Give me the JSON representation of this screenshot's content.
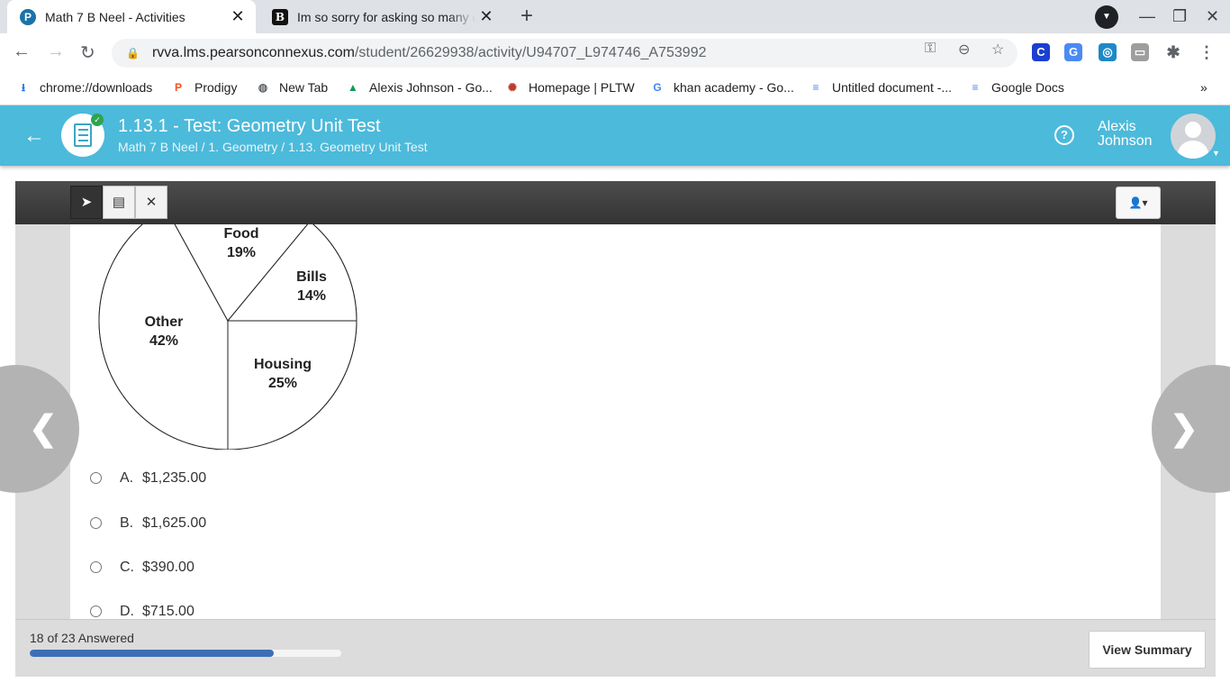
{
  "browser": {
    "tabs": [
      {
        "title": "Math 7 B Neel - Activities",
        "active": true,
        "close": "✕"
      },
      {
        "title": "Im so sorry for asking so many q",
        "active": false,
        "close": "✕"
      }
    ],
    "new_tab": "+",
    "window_controls": {
      "minimize": "—",
      "restore": "❐",
      "close": "✕"
    },
    "url_domain": "rvva.lms.pearsonconnexus.com",
    "url_path": "/student/26629938/activity/U94707_L974746_A753992",
    "bookmarks": [
      {
        "label": "chrome://downloads",
        "icon": "download-icon",
        "color": "#1a73e8",
        "glyph": "⭳"
      },
      {
        "label": "Prodigy",
        "icon": "prodigy-icon",
        "color": "#f4511e",
        "glyph": "P"
      },
      {
        "label": "New Tab",
        "icon": "globe-icon",
        "color": "#5f6368",
        "glyph": "◍"
      },
      {
        "label": "Alexis Johnson - Go...",
        "icon": "drive-icon",
        "color": "#0f9d58",
        "glyph": "▲"
      },
      {
        "label": "Homepage | PLTW",
        "icon": "pltw-icon",
        "color": "#c0392b",
        "glyph": "✺"
      },
      {
        "label": "khan academy - Go...",
        "icon": "google-icon",
        "color": "#4285f4",
        "glyph": "G"
      },
      {
        "label": "Untitled document -...",
        "icon": "docs-icon",
        "color": "#4285f4",
        "glyph": "≡"
      },
      {
        "label": "Google Docs",
        "icon": "docs-icon",
        "color": "#4285f4",
        "glyph": "≡"
      }
    ],
    "more_bookmarks": "»"
  },
  "header": {
    "title": "1.13.1 - Test: Geometry Unit Test",
    "breadcrumb": "Math 7 B Neel / 1. Geometry / 1.13. Geometry Unit Test",
    "user_first": "Alexis",
    "user_last": "Johnson",
    "accent_color": "#4cbadb"
  },
  "chart_data": {
    "type": "pie",
    "slices": [
      {
        "label": "Food",
        "value": 19,
        "display": "19%"
      },
      {
        "label": "Bills",
        "value": 14,
        "display": "14%"
      },
      {
        "label": "Housing",
        "value": 25,
        "display": "25%"
      },
      {
        "label": "Other",
        "value": 42,
        "display": "42%"
      }
    ]
  },
  "question": {
    "choices": [
      {
        "letter": "A.",
        "text": "$1,235.00"
      },
      {
        "letter": "B.",
        "text": "$1,625.00"
      },
      {
        "letter": "C.",
        "text": "$390.00"
      },
      {
        "letter": "D.",
        "text": "$715.00"
      }
    ]
  },
  "footer": {
    "answered_text": "18 of 23 Answered",
    "answered": 18,
    "total": 23,
    "summary_label": "View Summary",
    "progress_color": "#3d6fb6"
  }
}
